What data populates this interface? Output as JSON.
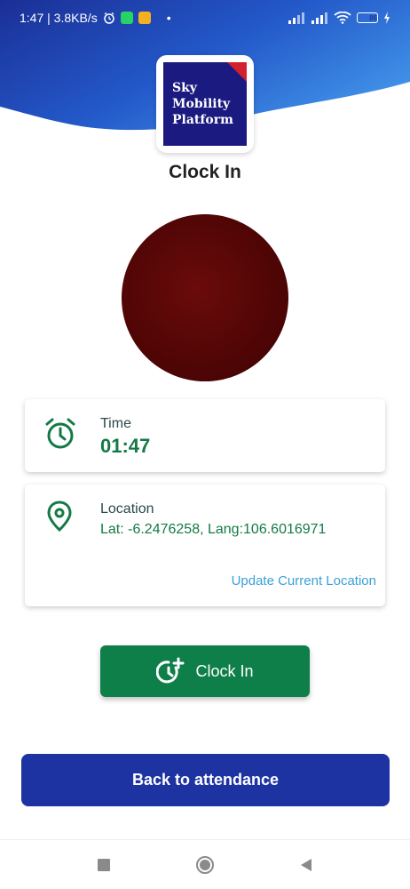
{
  "status_bar": {
    "time_speed": "1:47 | 3.8KB/s",
    "battery": "86",
    "colors": {
      "whatsapp": "#25d366",
      "notes": "#f5b021"
    }
  },
  "logo": {
    "line1": "Sky",
    "line2": "Mobility",
    "line3": "Platform"
  },
  "page_title": "Clock In",
  "time_card": {
    "label": "Time",
    "value": "01:47"
  },
  "location_card": {
    "label": "Location",
    "value": "Lat: -6.2476258, Lang:106.6016971",
    "update_link": "Update Current Location"
  },
  "clock_in_button": {
    "label": "Clock In"
  },
  "back_button": {
    "label": "Back to attendance"
  },
  "theme": {
    "primary_blue": "#1d33a2",
    "green": "#0e7f49",
    "link_blue": "#3ba0d8",
    "photo_color": "#500505"
  },
  "icons": {
    "time": "alarm-clock-icon",
    "location": "location-pin-icon",
    "clock_in": "clock-add-icon",
    "nav": [
      "recents-square-icon",
      "home-circle-icon",
      "back-triangle-icon"
    ]
  }
}
